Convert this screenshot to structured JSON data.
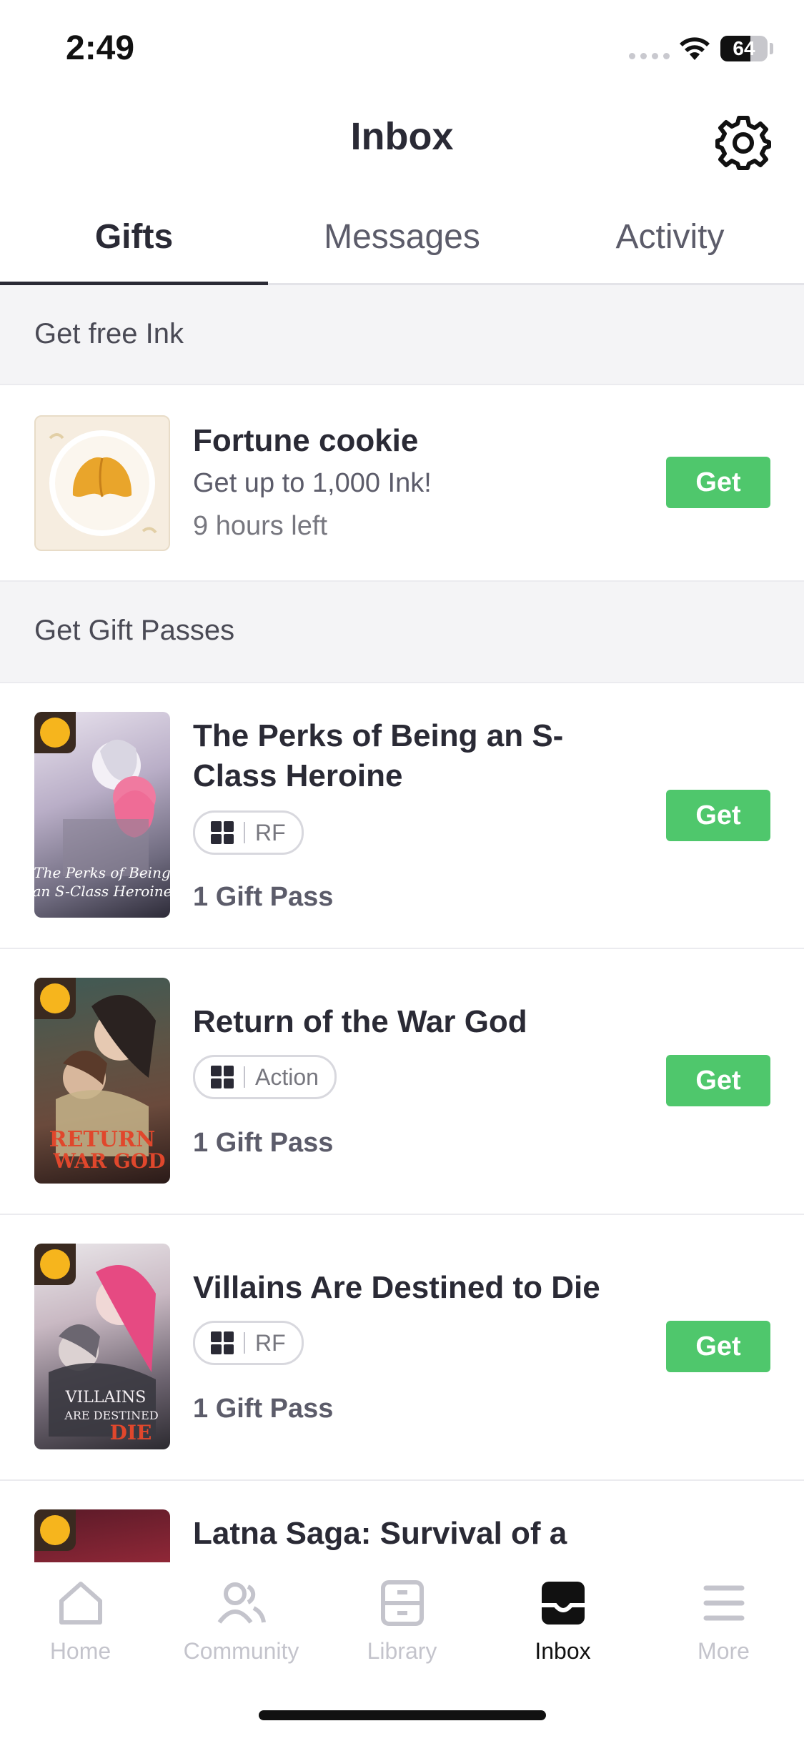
{
  "status_bar": {
    "time": "2:49",
    "battery": "64",
    "battery_level": 0.64
  },
  "header": {
    "title": "Inbox"
  },
  "tabs": [
    {
      "label": "Gifts",
      "active": true
    },
    {
      "label": "Messages",
      "active": false
    },
    {
      "label": "Activity",
      "active": false
    }
  ],
  "sections": {
    "free_ink": "Get free Ink",
    "gift_passes": "Get Gift Passes"
  },
  "fortune": {
    "title": "Fortune cookie",
    "subtitle": "Get up to 1,000 Ink!",
    "time_left": "9 hours left",
    "button": "Get"
  },
  "gift_items": [
    {
      "title": "The Perks of Being an S-Class Heroine",
      "genre": "RF",
      "pass": "1 Gift Pass",
      "button": "Get",
      "cover_text": "The Perks of Being an S-Class Heroine"
    },
    {
      "title": "Return of the War God",
      "genre": "Action",
      "pass": "1 Gift Pass",
      "button": "Get",
      "cover_text": "RETURN OF THE WAR GOD"
    },
    {
      "title": "Villains Are Destined to Die",
      "genre": "RF",
      "pass": "1 Gift Pass",
      "button": "Get",
      "cover_text": "VILLAINS ARE DESTINED TO DIE"
    },
    {
      "title": "Latna Saga: Survival of a"
    }
  ],
  "nav": [
    {
      "label": "Home",
      "icon": "home-icon"
    },
    {
      "label": "Community",
      "icon": "community-icon"
    },
    {
      "label": "Library",
      "icon": "library-icon"
    },
    {
      "label": "Inbox",
      "icon": "inbox-icon",
      "active": true
    },
    {
      "label": "More",
      "icon": "menu-icon"
    }
  ],
  "colors": {
    "accent": "#4fc76c",
    "text": "#2a2a35",
    "clock_badge": "#f6b51d"
  }
}
